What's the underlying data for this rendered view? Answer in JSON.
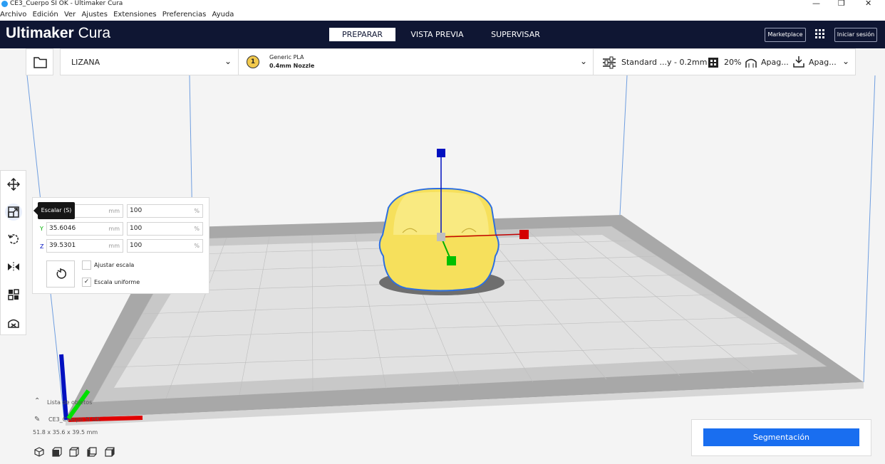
{
  "window": {
    "title": "CE3_Cuerpo SI OK - Ultimaker Cura",
    "controls": [
      "—",
      "❐",
      "✕"
    ]
  },
  "menubar": [
    "Archivo",
    "Edición",
    "Ver",
    "Ajustes",
    "Extensiones",
    "Preferencias",
    "Ayuda"
  ],
  "header": {
    "logo_bold": "Ultimaker",
    "logo_light": "Cura",
    "stages": [
      "PREPARAR",
      "VISTA PREVIA",
      "SUPERVISAR"
    ],
    "active_stage": "PREPARAR",
    "marketplace": "Marketplace",
    "signin": "Iniciar sesión"
  },
  "toolbar": {
    "printer": "LIZANA",
    "extruder_number": "1",
    "material": "Generic PLA",
    "nozzle": "0.4mm Nozzle",
    "profile": "Standard ...y - 0.2mm",
    "infill": "20%",
    "support": "Apag...",
    "adhesion": "Apag..."
  },
  "scale_panel": {
    "tooltip": "Escalar (S)",
    "x_label": "X",
    "y_label": "Y",
    "z_label": "Z",
    "x_mm": "",
    "y_mm": "35.6046",
    "z_mm": "39.5301",
    "x_pct": "100",
    "y_pct": "100",
    "z_pct": "100",
    "unit_mm": "mm",
    "unit_pct": "%",
    "snap_label": "Ajustar escala",
    "uniform_label": "Escala uniforme",
    "snap_checked": false,
    "uniform_checked": true
  },
  "object_list": {
    "header": "Lista de objetos",
    "object_name": "CE3_Cuerpo SI OK",
    "dimensions": "51.8 x 35.6 x 39.5 mm"
  },
  "slice": {
    "button": "Segmentación"
  },
  "colors": {
    "header_bg": "#0f1633",
    "accent": "#196ef0",
    "model": "#f6e05c",
    "axis_x": "#e00000",
    "axis_y": "#00c000",
    "axis_z": "#0010c0"
  }
}
